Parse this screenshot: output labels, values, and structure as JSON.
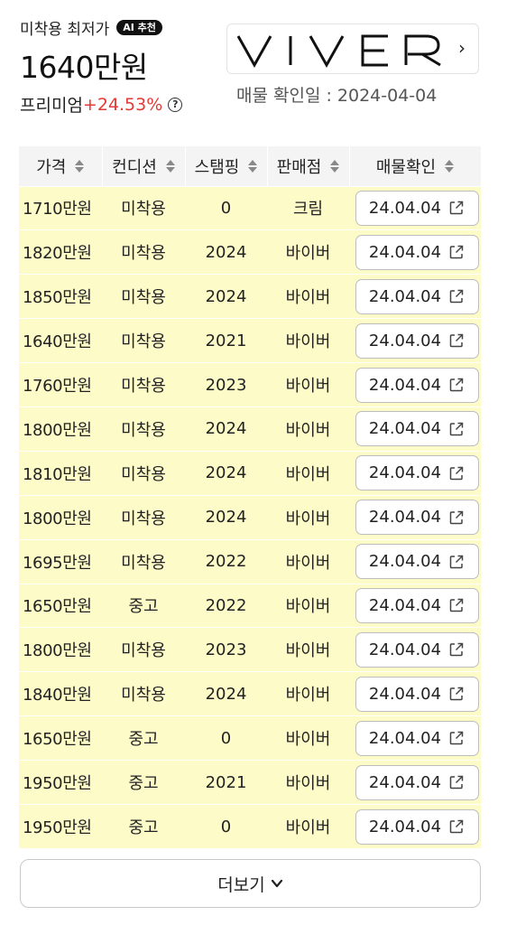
{
  "header": {
    "lowest_label": "미착용 최저가",
    "ai_badge": "AI 추천",
    "lowest_price": "1640만원",
    "premium_label": "프리미엄",
    "premium_value": "+24.53%",
    "help_icon": "?",
    "brand_logo": "VIVER",
    "brand_chevron": "›",
    "check_date": "매물 확인일 : 2024-04-04"
  },
  "table": {
    "columns": [
      "가격",
      "컨디션",
      "스탬핑",
      "판매점",
      "매물확인"
    ],
    "rows": [
      {
        "price": "1710만원",
        "condition": "미착용",
        "stamping": "0",
        "seller": "크림",
        "checked": "24.04.04"
      },
      {
        "price": "1820만원",
        "condition": "미착용",
        "stamping": "2024",
        "seller": "바이버",
        "checked": "24.04.04"
      },
      {
        "price": "1850만원",
        "condition": "미착용",
        "stamping": "2024",
        "seller": "바이버",
        "checked": "24.04.04"
      },
      {
        "price": "1640만원",
        "condition": "미착용",
        "stamping": "2021",
        "seller": "바이버",
        "checked": "24.04.04"
      },
      {
        "price": "1760만원",
        "condition": "미착용",
        "stamping": "2023",
        "seller": "바이버",
        "checked": "24.04.04"
      },
      {
        "price": "1800만원",
        "condition": "미착용",
        "stamping": "2024",
        "seller": "바이버",
        "checked": "24.04.04"
      },
      {
        "price": "1810만원",
        "condition": "미착용",
        "stamping": "2024",
        "seller": "바이버",
        "checked": "24.04.04"
      },
      {
        "price": "1800만원",
        "condition": "미착용",
        "stamping": "2024",
        "seller": "바이버",
        "checked": "24.04.04"
      },
      {
        "price": "1695만원",
        "condition": "미착용",
        "stamping": "2022",
        "seller": "바이버",
        "checked": "24.04.04"
      },
      {
        "price": "1650만원",
        "condition": "중고",
        "stamping": "2022",
        "seller": "바이버",
        "checked": "24.04.04"
      },
      {
        "price": "1800만원",
        "condition": "미착용",
        "stamping": "2023",
        "seller": "바이버",
        "checked": "24.04.04"
      },
      {
        "price": "1840만원",
        "condition": "미착용",
        "stamping": "2024",
        "seller": "바이버",
        "checked": "24.04.04"
      },
      {
        "price": "1650만원",
        "condition": "중고",
        "stamping": "0",
        "seller": "바이버",
        "checked": "24.04.04"
      },
      {
        "price": "1950만원",
        "condition": "중고",
        "stamping": "2021",
        "seller": "바이버",
        "checked": "24.04.04"
      },
      {
        "price": "1950만원",
        "condition": "중고",
        "stamping": "0",
        "seller": "바이버",
        "checked": "24.04.04"
      }
    ]
  },
  "more_button": {
    "label": "더보기",
    "icon": "chevron-down-icon"
  },
  "colors": {
    "row_highlight": "#fdfcc8",
    "premium_red": "#e53935",
    "header_bg": "#f4f4f4"
  }
}
